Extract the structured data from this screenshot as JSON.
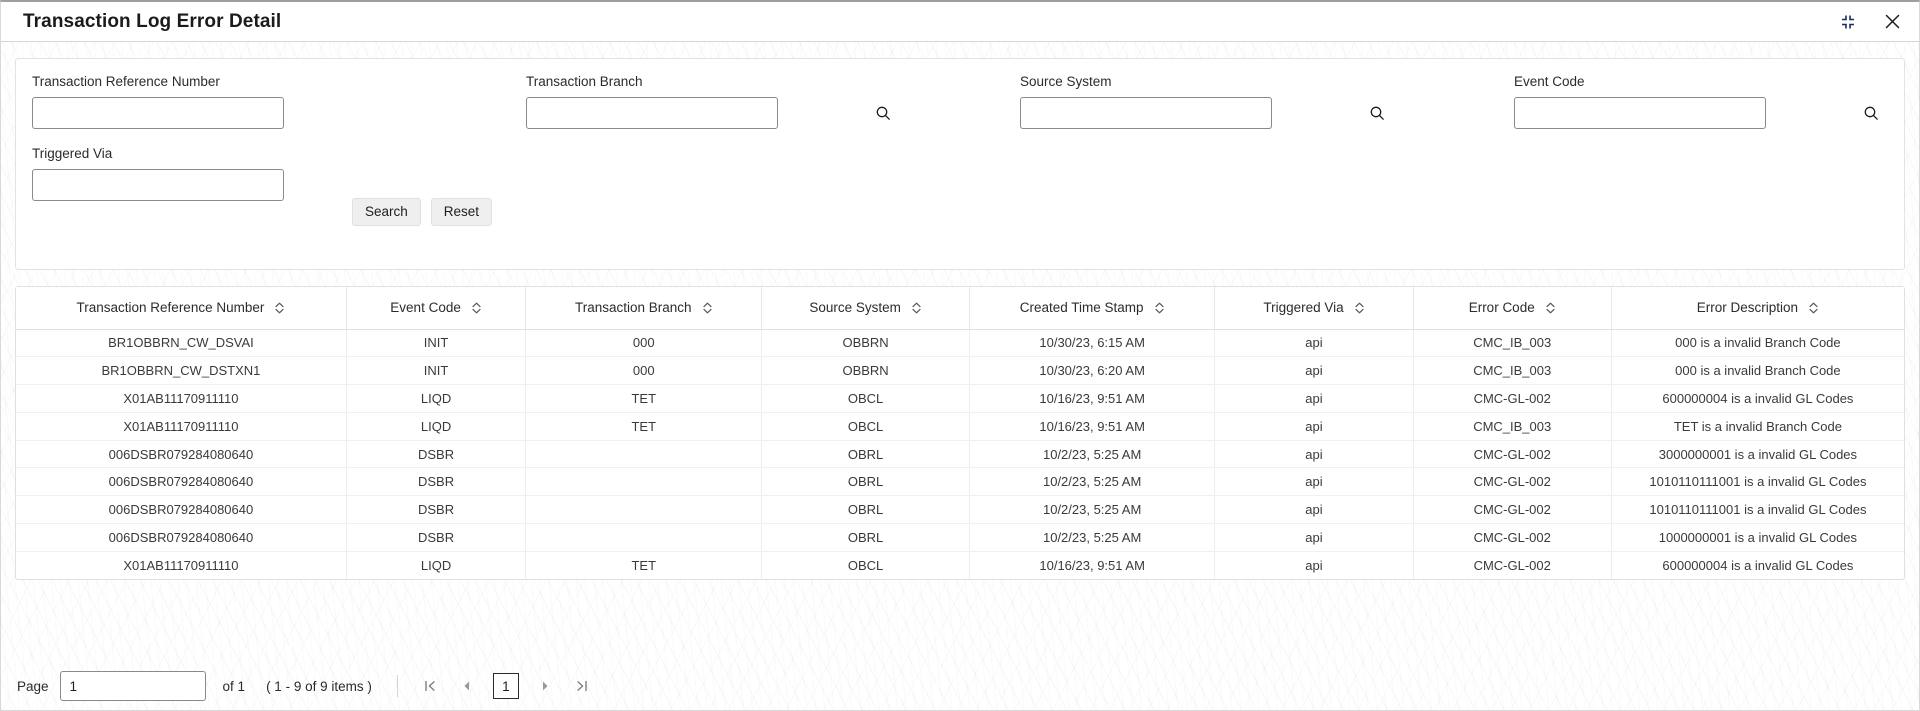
{
  "window": {
    "title": "Transaction Log Error Detail",
    "controls": [
      {
        "name": "collapse-icon",
        "label": "Minimize"
      },
      {
        "name": "close-icon",
        "label": "Close"
      }
    ]
  },
  "filter_panel": {
    "fields": [
      {
        "label": "Transaction Reference Number",
        "value": "",
        "placeholder": "",
        "has_lov": false
      },
      {
        "label": "Transaction Branch",
        "value": "",
        "placeholder": "",
        "has_lov": true
      },
      {
        "label": "Source System",
        "value": "",
        "placeholder": "",
        "has_lov": true
      },
      {
        "label": "Event Code",
        "value": "",
        "placeholder": "",
        "has_lov": true
      },
      {
        "label": "Triggered Via",
        "value": "",
        "placeholder": "",
        "has_lov": false
      }
    ],
    "buttons": {
      "search": "Search",
      "reset": "Reset"
    }
  },
  "table": {
    "columns": [
      "Transaction Reference Number",
      "Event Code",
      "Transaction Branch",
      "Source System",
      "Created Time Stamp",
      "Triggered Via",
      "Error Code",
      "Error Description"
    ],
    "rows": [
      [
        "BR1OBBRN_CW_DSVAI",
        "INIT",
        "000",
        "OBBRN",
        "10/30/23, 6:15 AM",
        "api",
        "CMC_IB_003",
        "000 is a invalid Branch Code"
      ],
      [
        "BR1OBBRN_CW_DSTXN1",
        "INIT",
        "000",
        "OBBRN",
        "10/30/23, 6:20 AM",
        "api",
        "CMC_IB_003",
        "000 is a invalid Branch Code"
      ],
      [
        "X01AB11170911110",
        "LIQD",
        "TET",
        "OBCL",
        "10/16/23, 9:51 AM",
        "api",
        "CMC-GL-002",
        "600000004 is a invalid GL Codes"
      ],
      [
        "X01AB11170911110",
        "LIQD",
        "TET",
        "OBCL",
        "10/16/23, 9:51 AM",
        "api",
        "CMC_IB_003",
        "TET is a invalid Branch Code"
      ],
      [
        "006DSBR079284080640",
        "DSBR",
        "",
        "OBRL",
        "10/2/23, 5:25 AM",
        "api",
        "CMC-GL-002",
        "3000000001 is a invalid GL Codes"
      ],
      [
        "006DSBR079284080640",
        "DSBR",
        "",
        "OBRL",
        "10/2/23, 5:25 AM",
        "api",
        "CMC-GL-002",
        "1010110111001 is a invalid GL Codes"
      ],
      [
        "006DSBR079284080640",
        "DSBR",
        "",
        "OBRL",
        "10/2/23, 5:25 AM",
        "api",
        "CMC-GL-002",
        "1010110111001 is a invalid GL Codes"
      ],
      [
        "006DSBR079284080640",
        "DSBR",
        "",
        "OBRL",
        "10/2/23, 5:25 AM",
        "api",
        "CMC-GL-002",
        "1000000001 is a invalid GL Codes"
      ],
      [
        "X01AB11170911110",
        "LIQD",
        "TET",
        "OBCL",
        "10/16/23, 9:51 AM",
        "api",
        "CMC-GL-002",
        "600000004 is a invalid GL Codes"
      ]
    ]
  },
  "pagination": {
    "page_label": "Page",
    "page_value": "1",
    "of_text": "of 1",
    "items_text": "( 1 - 9 of 9 items )",
    "current_page": "1",
    "buttons": {
      "first": "first-page",
      "prev": "previous-page",
      "next": "next-page",
      "last": "last-page"
    }
  },
  "colors": {
    "accent": "#2b2b2b",
    "border": "#e0e0e0",
    "text": "#2b2b2b"
  }
}
